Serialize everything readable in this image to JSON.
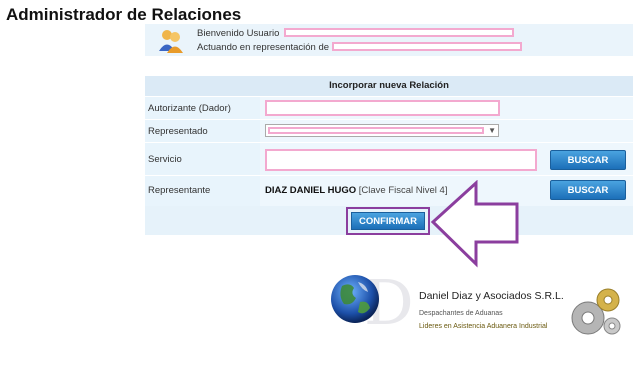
{
  "page": {
    "title": "Administrador de Relaciones"
  },
  "user": {
    "welcome_label": "Bienvenido Usuario",
    "acting_label": "Actuando en representación de"
  },
  "form": {
    "header": "Incorporar nueva Relación",
    "rows": [
      {
        "label": "Autorizante (Dador)"
      },
      {
        "label": "Representado"
      },
      {
        "label": "Servicio",
        "button": "BUSCAR"
      },
      {
        "label": "Representante",
        "button": "BUSCAR",
        "name": "DIAZ DANIEL HUGO",
        "detail": "[Clave Fiscal Nivel 4]"
      }
    ],
    "confirm_label": "CONFIRMAR"
  },
  "logo": {
    "company": "Daniel Diaz y Asociados S.R.L.",
    "tagline1": "Despachantes de Aduanas",
    "tagline2": "Lideres en Asistencia Aduanera Industrial",
    "accent_color": "#8b3e9e"
  }
}
